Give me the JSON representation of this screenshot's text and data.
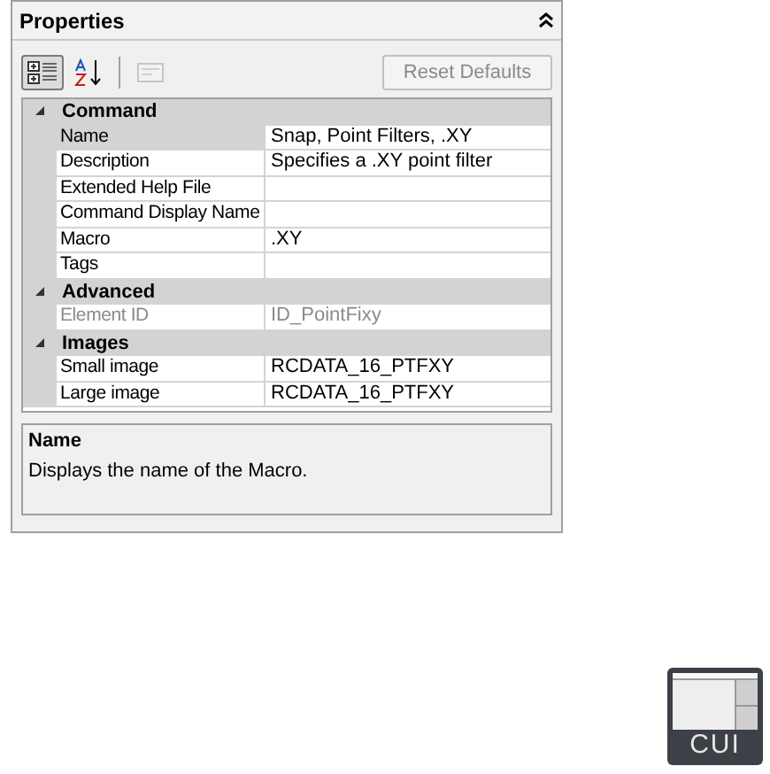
{
  "panel": {
    "title": "Properties",
    "collapsed": false
  },
  "toolbar": {
    "buttons": [
      {
        "kind": "categorized",
        "selected": true,
        "disabled": false
      },
      {
        "kind": "alphabetical",
        "selected": false,
        "disabled": false
      },
      {
        "kind": "pages",
        "selected": false,
        "disabled": true
      }
    ],
    "reset": {
      "label": "Reset Defaults",
      "disabled": true
    }
  },
  "grid": {
    "categories": [
      {
        "name": "Command",
        "expanded": true,
        "items": [
          {
            "label": "Name",
            "value": "Snap, Point Filters, .XY",
            "selected": true,
            "disabled": false
          },
          {
            "label": "Description",
            "value": "Specifies a .XY point filter",
            "selected": false,
            "disabled": false
          },
          {
            "label": "Extended Help File",
            "selected": false,
            "disabled": false
          },
          {
            "label": "Command Display Name",
            "selected": false,
            "disabled": false
          },
          {
            "label": "Macro",
            "value": ".XY",
            "selected": false,
            "disabled": false
          },
          {
            "label": "Tags",
            "selected": false,
            "disabled": false
          }
        ]
      },
      {
        "name": "Advanced",
        "expanded": true,
        "items": [
          {
            "label": "Element ID",
            "value": "ID_PointFixy",
            "selected": false,
            "disabled": true
          }
        ]
      },
      {
        "name": "Images",
        "expanded": true,
        "items": [
          {
            "label": "Small image",
            "value": "RCDATA_16_PTFXY",
            "selected": false,
            "disabled": false
          },
          {
            "label": "Large image",
            "value": "RCDATA_16_PTFXY",
            "selected": false,
            "disabled": false
          }
        ]
      }
    ]
  },
  "help": {
    "title": "Name",
    "text": "Displays the name of the Macro."
  },
  "badge": {
    "label": "CUI"
  }
}
